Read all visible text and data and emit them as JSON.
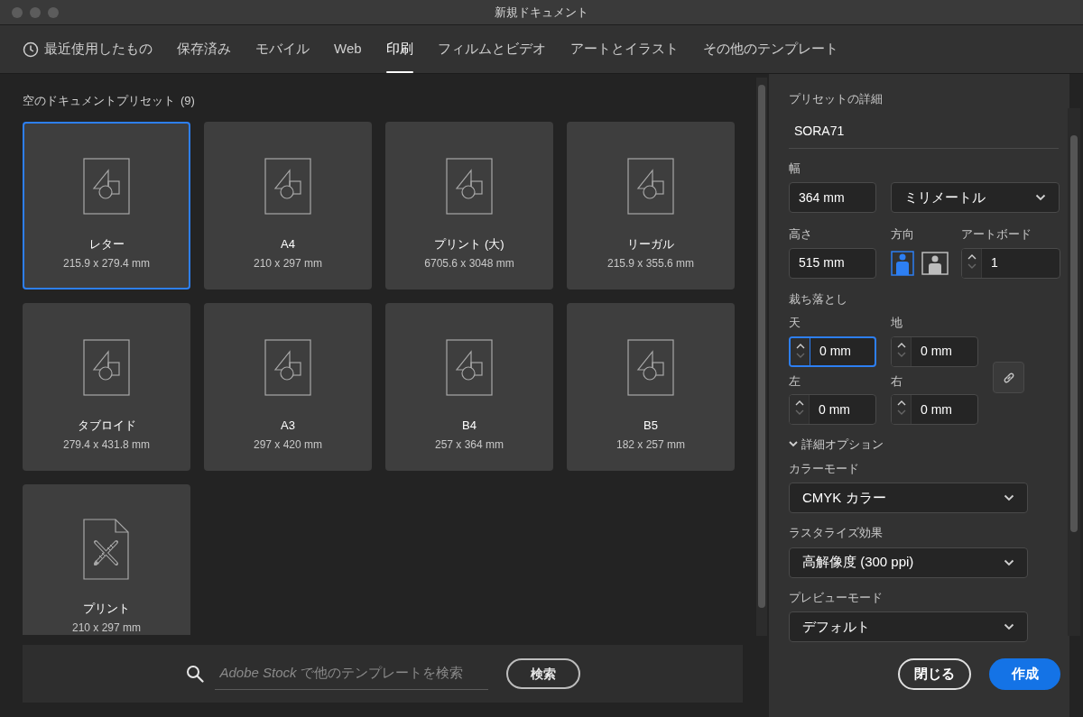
{
  "window": {
    "title": "新規ドキュメント"
  },
  "tabs": [
    {
      "label": "最近使用したもの",
      "kind": "recent",
      "selected": false
    },
    {
      "label": "保存済み",
      "kind": "category",
      "selected": false
    },
    {
      "label": "モバイル",
      "kind": "category",
      "selected": false
    },
    {
      "label": "Web",
      "kind": "category",
      "selected": false
    },
    {
      "label": "印刷",
      "kind": "category",
      "selected": true
    },
    {
      "label": "フィルムとビデオ",
      "kind": "category",
      "selected": false
    },
    {
      "label": "アートとイラスト",
      "kind": "category",
      "selected": false
    },
    {
      "label": "その他のテンプレート",
      "kind": "category",
      "selected": false
    }
  ],
  "presets": {
    "heading": "空のドキュメントプリセット",
    "count": "(9)",
    "items": [
      {
        "name": "レター",
        "size": "215.9 x 279.4 mm",
        "kind": "blank",
        "selected": true
      },
      {
        "name": "A4",
        "size": "210 x 297 mm",
        "kind": "blank",
        "selected": false
      },
      {
        "name": "プリント (大)",
        "size": "6705.6 x 3048 mm",
        "kind": "blank",
        "selected": false
      },
      {
        "name": "リーガル",
        "size": "215.9 x 355.6 mm",
        "kind": "blank",
        "selected": false
      },
      {
        "name": "タブロイド",
        "size": "279.4 x 431.8 mm",
        "kind": "blank",
        "selected": false
      },
      {
        "name": "A3",
        "size": "297 x 420 mm",
        "kind": "blank",
        "selected": false
      },
      {
        "name": "B4",
        "size": "257 x 364 mm",
        "kind": "blank",
        "selected": false
      },
      {
        "name": "B5",
        "size": "182 x 257 mm",
        "kind": "blank",
        "selected": false
      },
      {
        "name": "プリント",
        "size": "210 x 297 mm",
        "kind": "template",
        "selected": false
      }
    ]
  },
  "search": {
    "placeholder": "*Adobe Stock* で他のテンプレートを検索",
    "button": "検索"
  },
  "details": {
    "heading": "プリセットの詳細",
    "preset_name": "SORA71",
    "width": {
      "label": "幅",
      "value": "364 mm"
    },
    "unit": {
      "value": "ミリメートル"
    },
    "height": {
      "label": "高さ",
      "value": "515 mm"
    },
    "orientation": {
      "label": "方向",
      "options": [
        {
          "kind": "portrait",
          "selected": true
        },
        {
          "kind": "landscape",
          "selected": false
        }
      ]
    },
    "artboards": {
      "label": "アートボード",
      "value": "1"
    },
    "bleed": {
      "label": "裁ち落とし",
      "fields": [
        {
          "label": "天",
          "value": "0 mm",
          "focused": true
        },
        {
          "label": "地",
          "value": "0 mm",
          "focused": false
        },
        {
          "label": "左",
          "value": "0 mm",
          "focused": false
        },
        {
          "label": "右",
          "value": "0 mm",
          "focused": false
        }
      ]
    },
    "advanced": {
      "label": "詳細オプション",
      "expanded": true
    },
    "dropdowns": [
      {
        "label": "カラーモード",
        "value": "CMYK カラー"
      },
      {
        "label": "ラスタライズ効果",
        "value": "高解像度 (300 ppi)"
      },
      {
        "label": "プレビューモード",
        "value": "デフォルト"
      }
    ],
    "buttons": [
      {
        "label": "閉じる",
        "kind": "secondary"
      },
      {
        "label": "作成",
        "kind": "primary"
      }
    ]
  }
}
